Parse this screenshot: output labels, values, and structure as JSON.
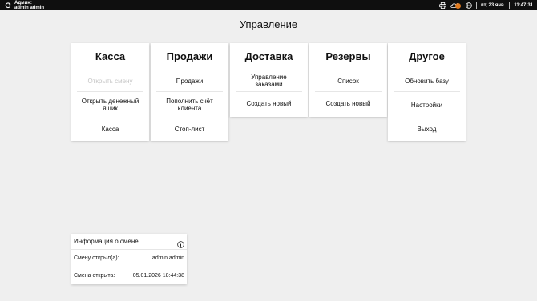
{
  "topbar": {
    "user_role": "Админ:",
    "user_name": "admin admin",
    "date": "пт, 23 янв.",
    "time": "11:47:31",
    "notifications_count": "1",
    "icons": [
      "sync-icon",
      "printer-icon",
      "cloud-icon",
      "globe-icon"
    ]
  },
  "page": {
    "title": "Управление"
  },
  "cards": {
    "kassa": {
      "title": "Касса",
      "items": [
        "Открыть смену",
        "Открыть денежный ящик",
        "Касса"
      ]
    },
    "prodazhi": {
      "title": "Продажи",
      "items": [
        "Продажи",
        "Пополнить счёт клиента",
        "Стоп-лист"
      ]
    },
    "dostavka": {
      "title": "Доставка",
      "items": [
        "Управление заказами",
        "Создать новый"
      ]
    },
    "rezervy": {
      "title": "Резервы",
      "items": [
        "Список",
        "Создать новый"
      ]
    },
    "drugoe": {
      "title": "Другое",
      "items": [
        "Обновить базу",
        "Настройки",
        "Выход"
      ]
    }
  },
  "shift_info": {
    "title": "Информация о смене",
    "opened_by_label": "Смену открыл(а):",
    "opened_by_value": "admin admin",
    "opened_at_label": "Смена открыта:",
    "opened_at_value": "05.01.2026 18:44:38"
  },
  "colors": {
    "topbar": "#0f0f0f",
    "background": "#efefef",
    "badge": "#e07a1f",
    "disabled_text": "#c5c5c5"
  }
}
